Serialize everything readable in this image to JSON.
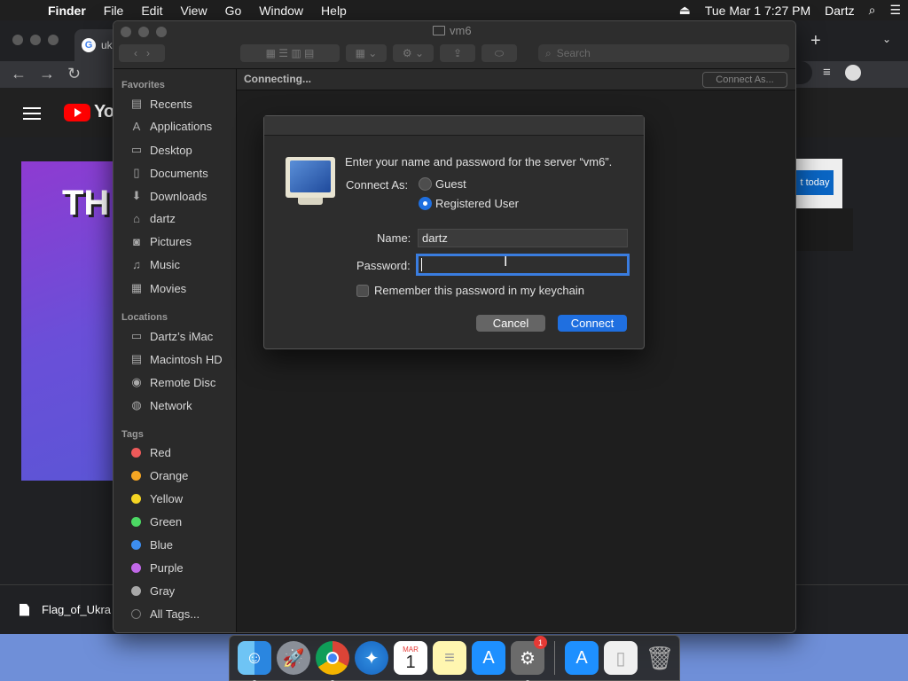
{
  "menubar": {
    "app_name": "Finder",
    "menus": [
      "File",
      "Edit",
      "View",
      "Go",
      "Window",
      "Help"
    ],
    "datetime": "Tue Mar 1  7:27 PM",
    "user": "Dartz"
  },
  "chrome": {
    "tab_title": "uk",
    "youtube_logo_text": "You",
    "banner_text": "TH",
    "promo_button": "t today",
    "download_file": "Flag_of_Ukra"
  },
  "finder": {
    "window_title": "vm6",
    "search_placeholder": "Search",
    "status": "Connecting...",
    "connect_as_button": "Connect As...",
    "sidebar": {
      "favorites_title": "Favorites",
      "favorites": [
        {
          "label": "Recents",
          "icon": "recents-icon"
        },
        {
          "label": "Applications",
          "icon": "applications-icon"
        },
        {
          "label": "Desktop",
          "icon": "desktop-icon"
        },
        {
          "label": "Documents",
          "icon": "documents-icon"
        },
        {
          "label": "Downloads",
          "icon": "downloads-icon"
        },
        {
          "label": "dartz",
          "icon": "home-icon"
        },
        {
          "label": "Pictures",
          "icon": "pictures-icon"
        },
        {
          "label": "Music",
          "icon": "music-icon"
        },
        {
          "label": "Movies",
          "icon": "movies-icon"
        }
      ],
      "locations_title": "Locations",
      "locations": [
        {
          "label": "Dartz’s iMac",
          "icon": "computer-icon"
        },
        {
          "label": "Macintosh HD",
          "icon": "hard-drive-icon"
        },
        {
          "label": "Remote Disc",
          "icon": "disc-icon"
        },
        {
          "label": "Network",
          "icon": "network-icon"
        }
      ],
      "tags_title": "Tags",
      "tags": [
        {
          "label": "Red",
          "color": "#ee5a5a"
        },
        {
          "label": "Orange",
          "color": "#f5a623"
        },
        {
          "label": "Yellow",
          "color": "#f5d523"
        },
        {
          "label": "Green",
          "color": "#4cd964"
        },
        {
          "label": "Blue",
          "color": "#3d8ef0"
        },
        {
          "label": "Purple",
          "color": "#c168e8"
        },
        {
          "label": "Gray",
          "color": "#a8a8a8"
        }
      ],
      "all_tags": "All Tags..."
    }
  },
  "dialog": {
    "prompt": "Enter your name and password for the server “vm6”.",
    "connect_as_label": "Connect As:",
    "option_guest": "Guest",
    "option_registered": "Registered User",
    "selected_option": "Registered User",
    "name_label": "Name:",
    "name_value": "dartz",
    "password_label": "Password:",
    "password_value": "",
    "remember_label": "Remember this password in my keychain",
    "remember_checked": false,
    "cancel_button": "Cancel",
    "connect_button": "Connect",
    "accent_color": "#1f6fe0"
  },
  "dock": {
    "calendar_month": "MAR",
    "calendar_day": "1",
    "system_prefs_badge": "1"
  }
}
